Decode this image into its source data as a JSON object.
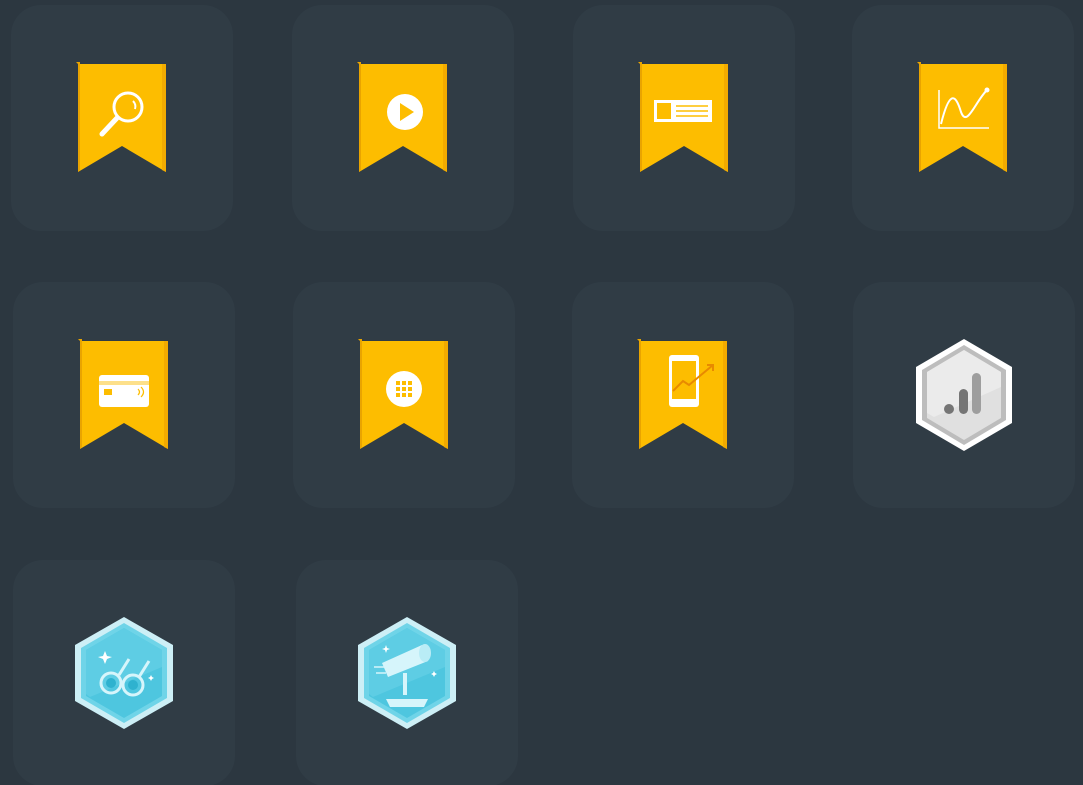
{
  "theme": {
    "background": "#2c3740",
    "tile": "#303c45",
    "ribbon_gold": "#fdbd00",
    "ribbon_shade": "#f2ab00",
    "hex_blue": "#5fcfe6",
    "hex_silver": "#bfbfbf"
  },
  "badges": [
    {
      "icon": "search-ribbon-badge-icon",
      "style": "ribbon",
      "glyph": "magnifier"
    },
    {
      "icon": "video-ribbon-badge-icon",
      "style": "ribbon",
      "glyph": "play"
    },
    {
      "icon": "display-ad-ribbon-badge-icon",
      "style": "ribbon",
      "glyph": "banner"
    },
    {
      "icon": "analytics-ribbon-badge-icon",
      "style": "ribbon",
      "glyph": "line-chart"
    },
    {
      "icon": "shopping-ribbon-badge-icon",
      "style": "ribbon",
      "glyph": "credit-card"
    },
    {
      "icon": "apps-ribbon-badge-icon",
      "style": "ribbon",
      "glyph": "grid"
    },
    {
      "icon": "mobile-ribbon-badge-icon",
      "style": "ribbon",
      "glyph": "phone-trend"
    },
    {
      "icon": "analytics-hex-badge-icon",
      "style": "hexagon-silver",
      "glyph": "bar-chart"
    },
    {
      "icon": "binoculars-hex-badge-icon",
      "style": "hexagon-blue",
      "glyph": "binoculars"
    },
    {
      "icon": "telescope-hex-badge-icon",
      "style": "hexagon-blue",
      "glyph": "telescope"
    }
  ]
}
